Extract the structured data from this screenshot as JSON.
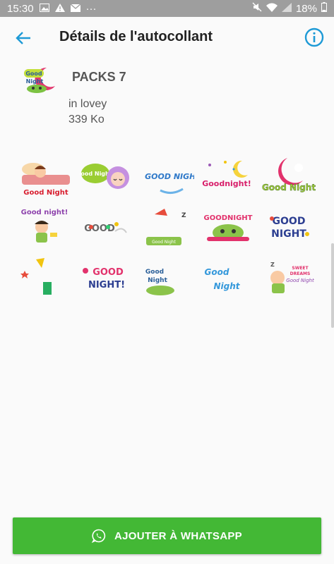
{
  "status_bar": {
    "time": "15:30",
    "dots": "···",
    "battery": "18%"
  },
  "header": {
    "title": "Détails de l'autocollant"
  },
  "pack": {
    "name": "PACKS 7",
    "author": "in lovey",
    "size": "339 Ko"
  },
  "stickers": [
    {
      "text": "Good Night"
    },
    {
      "text": "Good Night!"
    },
    {
      "text": "GOOD NIGHT"
    },
    {
      "text": "Goodnight!"
    },
    {
      "text": "Good Night"
    },
    {
      "text": "Good night!"
    },
    {
      "text": "GOOD"
    },
    {
      "text": "Good Night"
    },
    {
      "text": "GOODNIGHT"
    },
    {
      "text": "GOOD NIGHT"
    },
    {
      "text": ""
    },
    {
      "text": "GOOD NIGHT!"
    },
    {
      "text": "Good Night"
    },
    {
      "text": "Good Night"
    },
    {
      "text": "Good Night"
    }
  ],
  "add_button": {
    "label": "AJOUTER À WHATSAPP"
  },
  "colors": {
    "accent": "#1e9ad6",
    "button": "#43b835"
  }
}
